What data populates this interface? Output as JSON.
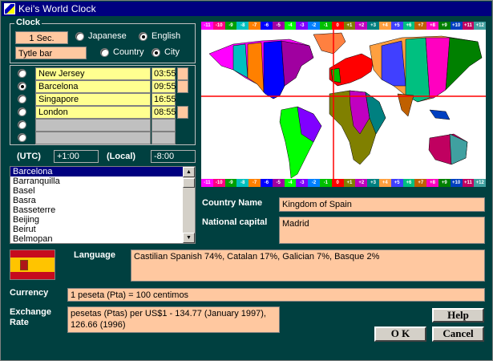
{
  "window": {
    "title": "Kei's World Clock"
  },
  "clock": {
    "group_label": "Clock",
    "interval": "1 Sec.",
    "display_mode": "Tytle bar",
    "lang_japanese": "Japanese",
    "lang_english": "English",
    "sel_country": "Country",
    "sel_city": "City"
  },
  "cities": [
    {
      "name": "New Jersey",
      "time": "03:55",
      "selected": false
    },
    {
      "name": "Barcelona",
      "time": "09:55",
      "selected": true
    },
    {
      "name": "Singapore",
      "time": "16:55",
      "selected": false
    },
    {
      "name": "London",
      "time": "08:55",
      "selected": false
    },
    {
      "name": "",
      "time": "",
      "selected": false
    },
    {
      "name": "",
      "time": "",
      "selected": false
    }
  ],
  "offsets": {
    "utc_label": "(UTC)",
    "utc_value": "+1:00",
    "local_label": "(Local)",
    "local_value": "-8:00"
  },
  "city_list": {
    "items": [
      "Barcelona",
      "Barranquilla",
      "Basel",
      "Basra",
      "Basseterre",
      "Beijing",
      "Beirut",
      "Belmopan"
    ],
    "selected": "Barcelona"
  },
  "timezones": {
    "bands": [
      "-11",
      "-10",
      "-9",
      "-8",
      "-7",
      "-6",
      "-5",
      "-4",
      "-3",
      "-2",
      "-1",
      "0",
      "+1",
      "+2",
      "+3",
      "+4",
      "+5",
      "+6",
      "+7",
      "+8",
      "+9",
      "+10",
      "+11",
      "+12"
    ],
    "colors": [
      "#ff00ff",
      "#ff0080",
      "#00a000",
      "#00c0c0",
      "#ff8000",
      "#0000ff",
      "#a000a0",
      "#00ff00",
      "#8000ff",
      "#0080ff",
      "#00c000",
      "#ff0000",
      "#808000",
      "#c000c0",
      "#008080",
      "#ffa040",
      "#4040ff",
      "#00c080",
      "#c06000",
      "#ff00c0",
      "#008000",
      "#0040c0",
      "#c00060",
      "#40a0a0"
    ]
  },
  "details": {
    "country_name_label": "Country Name",
    "country_name": "Kingdom of Spain",
    "capital_label": "National capital",
    "capital": "Madrid",
    "language_label": "Language",
    "language": "Castilian Spanish 74%, Catalan 17%, Galician 7%, Basque 2%",
    "currency_label": "Currency",
    "currency": "1 peseta (Pta) = 100 centimos",
    "exchange_label_1": "Exchange",
    "exchange_label_2": "Rate",
    "exchange": "pesetas (Ptas) per US$1 - 134.77 (January 1997), 126.66 (1996)"
  },
  "buttons": {
    "help": "Help",
    "ok": "O K",
    "cancel": "Cancel"
  }
}
